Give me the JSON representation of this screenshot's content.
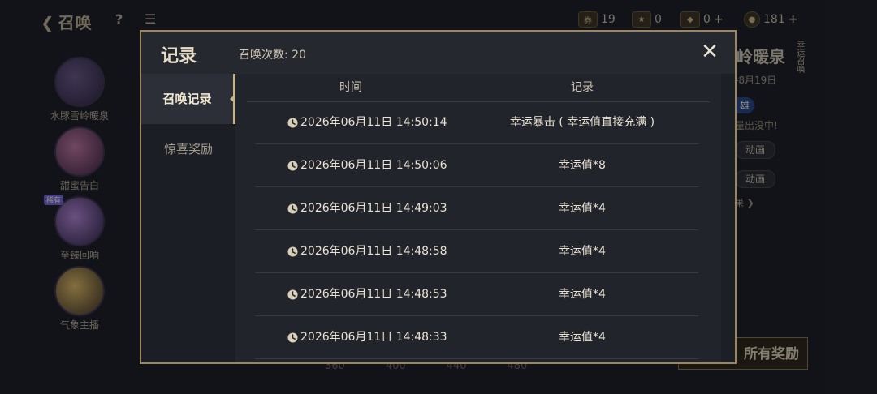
{
  "background": {
    "back_label": "召唤",
    "help_label": "?",
    "currencies": [
      {
        "icon": "ticket-icon",
        "value": "19",
        "has_plus": false
      },
      {
        "icon": "star-token-icon",
        "value": "0",
        "has_plus": false
      },
      {
        "icon": "gem-icon",
        "value": "0",
        "has_plus": true
      },
      {
        "icon": "coin-icon",
        "value": "181",
        "has_plus": true
      }
    ],
    "nav_items": [
      {
        "label": "水豚雪岭暖泉",
        "badge": ""
      },
      {
        "label": "甜蜜告白",
        "badge": ""
      },
      {
        "label": "至臻回响",
        "badge": "稀有"
      },
      {
        "label": "气象主播",
        "badge": ""
      }
    ],
    "right_panel": {
      "title": "岭暖泉",
      "vertical_tag": "幸运召唤",
      "date": "-8月19日",
      "hero_tag": "雄",
      "tip": "量出没中!",
      "anim_btn_1": "动画",
      "anim_btn_2": "动画",
      "link": "果",
      "claim_btn": "所有奖励"
    },
    "ticks": [
      "360",
      "400",
      "440",
      "480"
    ]
  },
  "modal": {
    "title": "记录",
    "summon_count_label": "召唤次数: 20",
    "close_icon": "close-icon",
    "tabs": [
      {
        "label": "召唤记录",
        "active": true
      },
      {
        "label": "惊喜奖励",
        "active": false
      }
    ],
    "columns": {
      "time": "时间",
      "record": "记录"
    },
    "rows": [
      {
        "time": "2026年06月11日  14:50:14",
        "record": "幸运暴击 ( 幸运值直接充满 )"
      },
      {
        "time": "2026年06月11日  14:50:06",
        "record": "幸运值*8"
      },
      {
        "time": "2026年06月11日  14:49:03",
        "record": "幸运值*4"
      },
      {
        "time": "2026年06月11日  14:48:58",
        "record": "幸运值*4"
      },
      {
        "time": "2026年06月11日  14:48:53",
        "record": "幸运值*4"
      },
      {
        "time": "2026年06月11日  14:48:33",
        "record": "幸运值*4"
      }
    ]
  },
  "colors": {
    "modal_border": "#9d875a",
    "accent_gold": "#c6b489",
    "text_main": "#e9e2d2"
  }
}
